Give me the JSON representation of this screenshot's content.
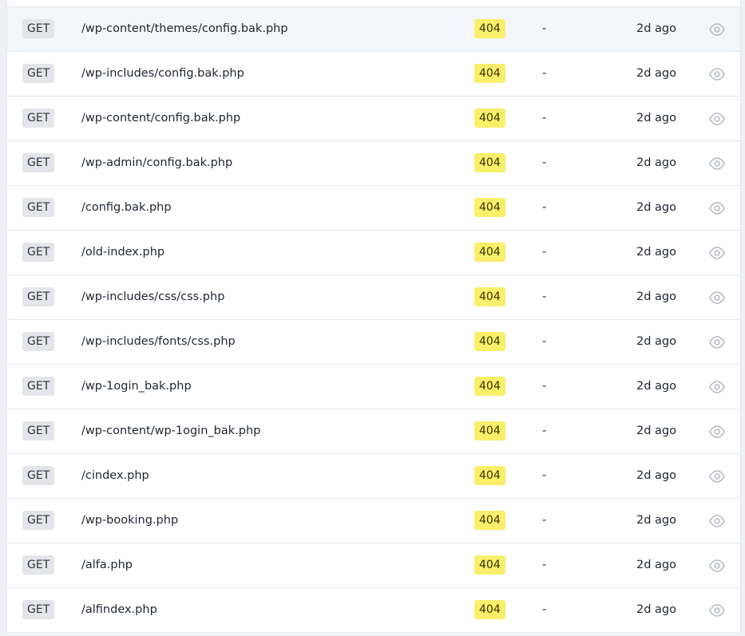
{
  "colors": {
    "method_badge_bg": "#e3e5e9",
    "status_badge_bg": "#f9ef6a",
    "row_hover_bg": "#f3f6fa",
    "icon": "#b4b9c2"
  },
  "icons": {
    "view": "eye-icon"
  },
  "requests": [
    {
      "method": "GET",
      "path": "/wp-content/themes/config.bak.php",
      "status": "404",
      "duration": "-",
      "time": "2d ago"
    },
    {
      "method": "GET",
      "path": "/wp-includes/config.bak.php",
      "status": "404",
      "duration": "-",
      "time": "2d ago"
    },
    {
      "method": "GET",
      "path": "/wp-content/config.bak.php",
      "status": "404",
      "duration": "-",
      "time": "2d ago"
    },
    {
      "method": "GET",
      "path": "/wp-admin/config.bak.php",
      "status": "404",
      "duration": "-",
      "time": "2d ago"
    },
    {
      "method": "GET",
      "path": "/config.bak.php",
      "status": "404",
      "duration": "-",
      "time": "2d ago"
    },
    {
      "method": "GET",
      "path": "/old-index.php",
      "status": "404",
      "duration": "-",
      "time": "2d ago"
    },
    {
      "method": "GET",
      "path": "/wp-includes/css/css.php",
      "status": "404",
      "duration": "-",
      "time": "2d ago"
    },
    {
      "method": "GET",
      "path": "/wp-includes/fonts/css.php",
      "status": "404",
      "duration": "-",
      "time": "2d ago"
    },
    {
      "method": "GET",
      "path": "/wp-1ogin_bak.php",
      "status": "404",
      "duration": "-",
      "time": "2d ago"
    },
    {
      "method": "GET",
      "path": "/wp-content/wp-1ogin_bak.php",
      "status": "404",
      "duration": "-",
      "time": "2d ago"
    },
    {
      "method": "GET",
      "path": "/cindex.php",
      "status": "404",
      "duration": "-",
      "time": "2d ago"
    },
    {
      "method": "GET",
      "path": "/wp-booking.php",
      "status": "404",
      "duration": "-",
      "time": "2d ago"
    },
    {
      "method": "GET",
      "path": "/alfa.php",
      "status": "404",
      "duration": "-",
      "time": "2d ago"
    },
    {
      "method": "GET",
      "path": "/alfindex.php",
      "status": "404",
      "duration": "-",
      "time": "2d ago"
    }
  ]
}
